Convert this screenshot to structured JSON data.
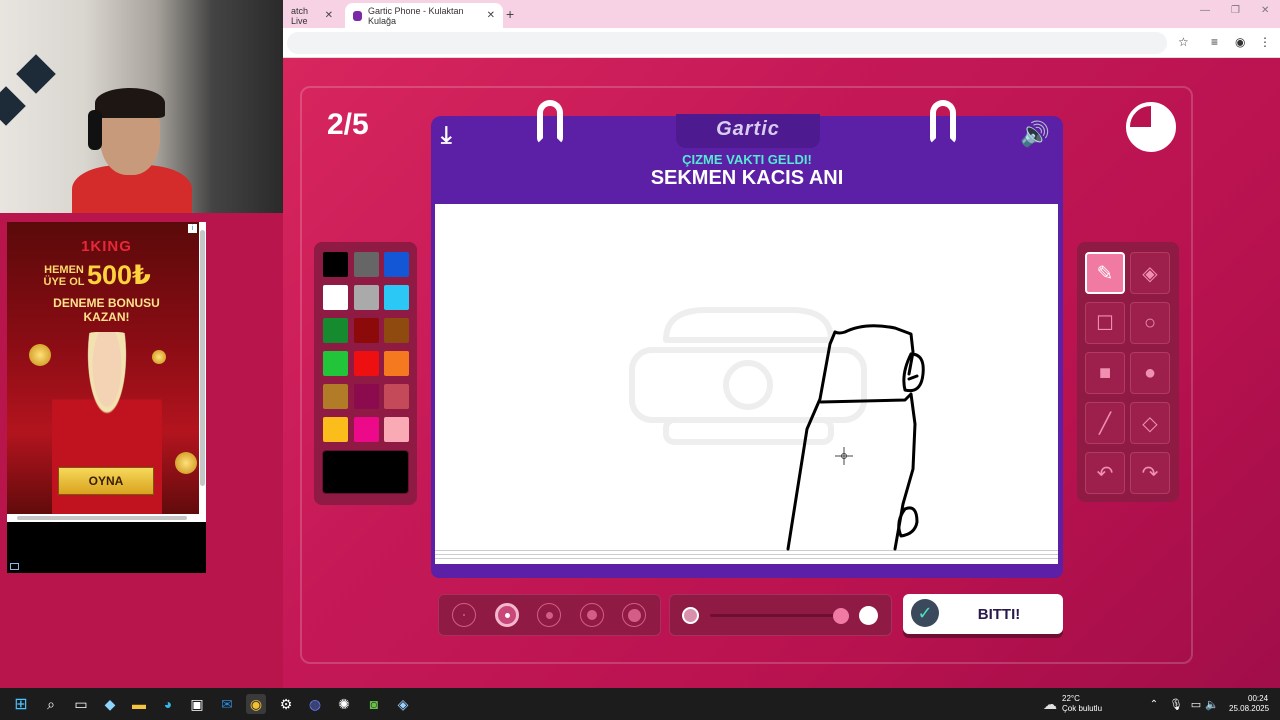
{
  "browser": {
    "tabs": [
      {
        "label": "atch Live"
      },
      {
        "label": "Gartic Phone - Kulaktan Kulağa"
      }
    ],
    "new_tab": "+"
  },
  "ad": {
    "logo": "1KING",
    "hemen": "HEMEN ÜYE OL",
    "amount": "500₺",
    "bonus_line1": "DENEME BONUSU",
    "bonus_line2": "KAZAN!",
    "button": "OYNA"
  },
  "game": {
    "round": "2/5",
    "logo": "Gartic",
    "subtitle": "ÇIZME VAKTI GELDI!",
    "prompt": "SEKMEN KACIS ANI",
    "done_label": "BITTI!",
    "colors": [
      [
        "#000000",
        "#666666",
        "#1357d6"
      ],
      [
        "#ffffff",
        "#aaaaaa",
        "#2bc8f5"
      ],
      [
        "#158a2e",
        "#8c0a0a",
        "#8f4a10"
      ],
      [
        "#22c43a",
        "#ee1010",
        "#f5791f"
      ],
      [
        "#b27b28",
        "#8c0a4e",
        "#c44a5a"
      ],
      [
        "#fbbd1c",
        "#ed0a8a",
        "#f9aab4"
      ]
    ],
    "current_color": "#000000",
    "selected_size_index": 1,
    "opacity": 0.95
  },
  "taskbar": {
    "weather_temp": "22°C",
    "weather_desc": "Çok bulutlu",
    "time": "00:24",
    "date": "25.08.2025"
  }
}
